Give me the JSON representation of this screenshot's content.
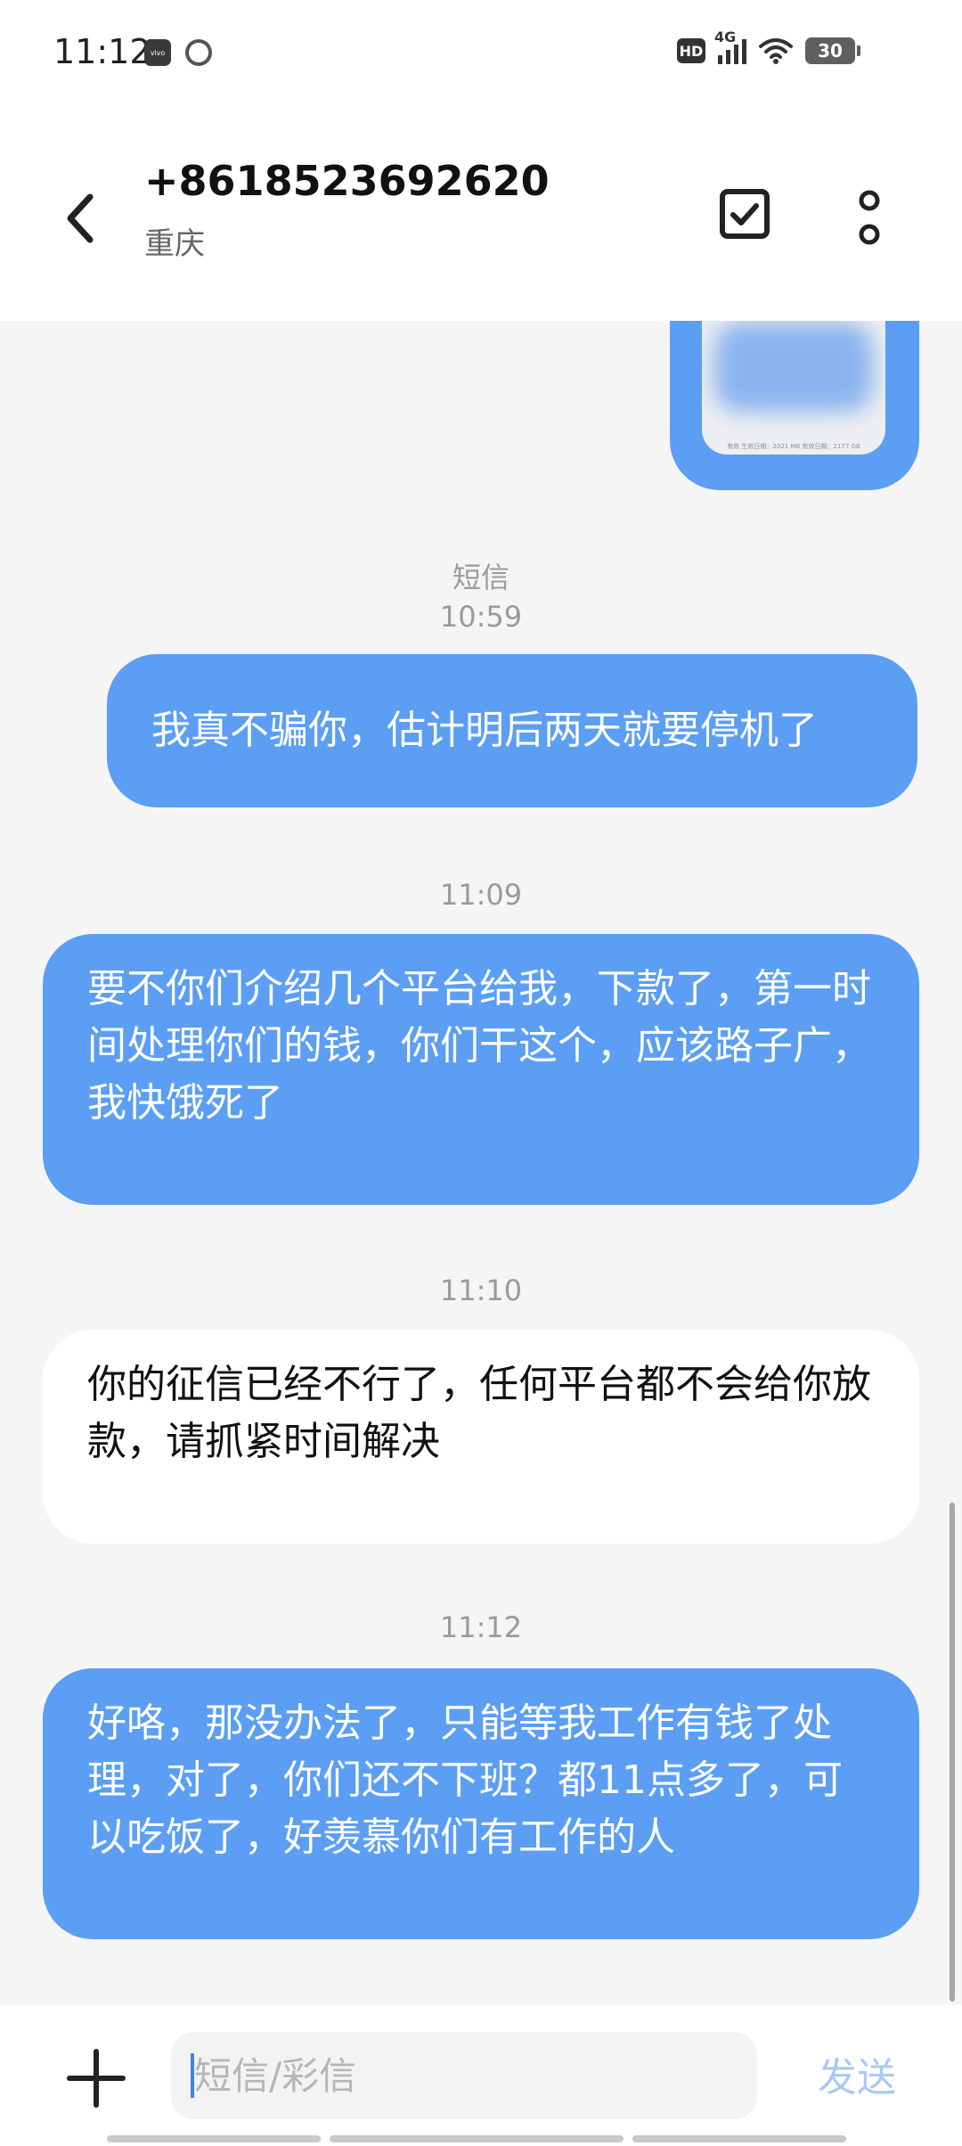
{
  "status_bar": {
    "time": "11:12",
    "vivo_label": "vivo",
    "hd_label": "HD",
    "network_label": "4G",
    "battery_level": "30"
  },
  "header": {
    "contact_number": "+8618523692620",
    "contact_location": "重庆"
  },
  "image_message": {
    "caption": "有效 生效日期：2021 MB 有效日期：2177 GB"
  },
  "messages": [
    {
      "type": "label",
      "channel": "短信",
      "time": "10:59"
    },
    {
      "type": "sent",
      "text": "我真不骗你，估计明后两天就要停机了"
    },
    {
      "type": "timestamp",
      "time": "11:09"
    },
    {
      "type": "sent",
      "text": "要不你们介绍几个平台给我，下款了，第一时间处理你们的钱，你们干这个，应该路子广，我快饿死了"
    },
    {
      "type": "timestamp",
      "time": "11:10"
    },
    {
      "type": "received",
      "text": "你的征信已经不行了，任何平台都不会给你放款，请抓紧时间解决"
    },
    {
      "type": "timestamp",
      "time": "11:12"
    },
    {
      "type": "sent",
      "text": "好咯，那没办法了，只能等我工作有钱了处理，对了，你们还不下班？都11点多了，可以吃饭了，好羡慕你们有工作的人"
    }
  ],
  "composer": {
    "placeholder": "短信/彩信",
    "send_label": "发送"
  },
  "icons": {
    "back": "chevron-left-icon",
    "select": "checkbox-icon",
    "more": "more-vertical-icon",
    "add": "plus-icon"
  },
  "colors": {
    "sent_bubble": "#5b9ef4",
    "received_bubble": "#ffffff",
    "background": "#f5f5f5",
    "send_disabled": "#a9c9f4"
  }
}
